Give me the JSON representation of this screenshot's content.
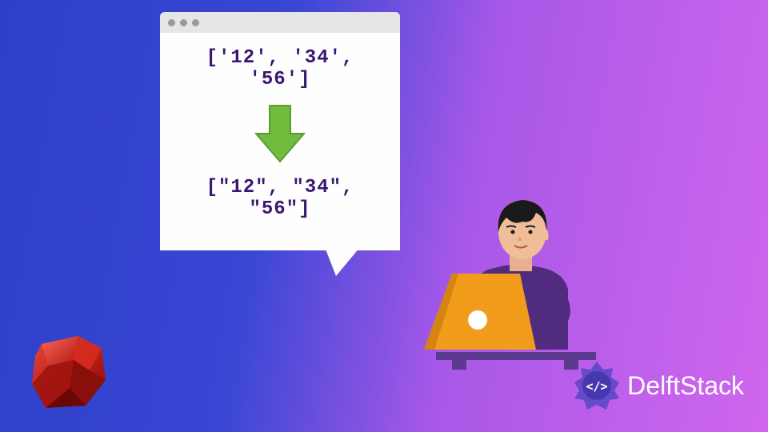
{
  "codeBefore": "['12', '34', '56']",
  "codeAfter": "[\"12\", \"34\", \"56\"]",
  "brand": "DelftStack",
  "icons": {
    "ruby": "ruby-logo",
    "arrow": "down-arrow",
    "brandEmblem": "delftstack-emblem"
  },
  "colors": {
    "windowTitle": "#e6e6e6",
    "codeText": "#3b1670",
    "arrow": "#72bb3d",
    "laptop": "#f19c1a",
    "shirt": "#502b7f"
  }
}
